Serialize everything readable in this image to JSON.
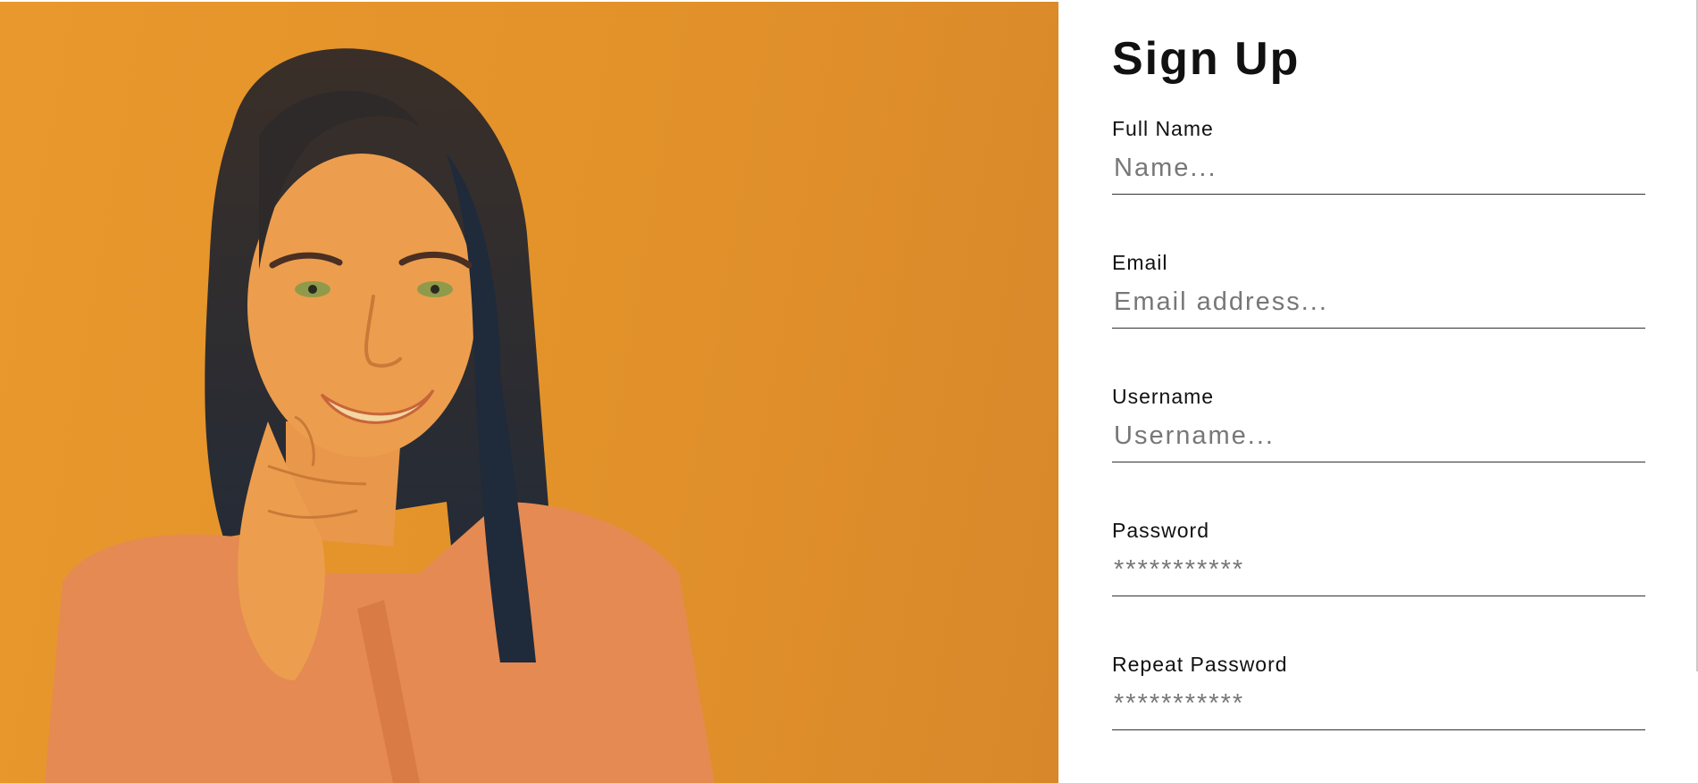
{
  "hero": {
    "image": "portrait-photo",
    "tint": "#e8982c"
  },
  "form": {
    "title": "Sign Up",
    "fields": [
      {
        "label": "Full Name",
        "placeholder": "Name..."
      },
      {
        "label": "Email",
        "placeholder": "Email address..."
      },
      {
        "label": "Username",
        "placeholder": "Username..."
      },
      {
        "label": "Password",
        "placeholder": "***********"
      },
      {
        "label": "Repeat Password",
        "placeholder": "***********"
      }
    ]
  }
}
